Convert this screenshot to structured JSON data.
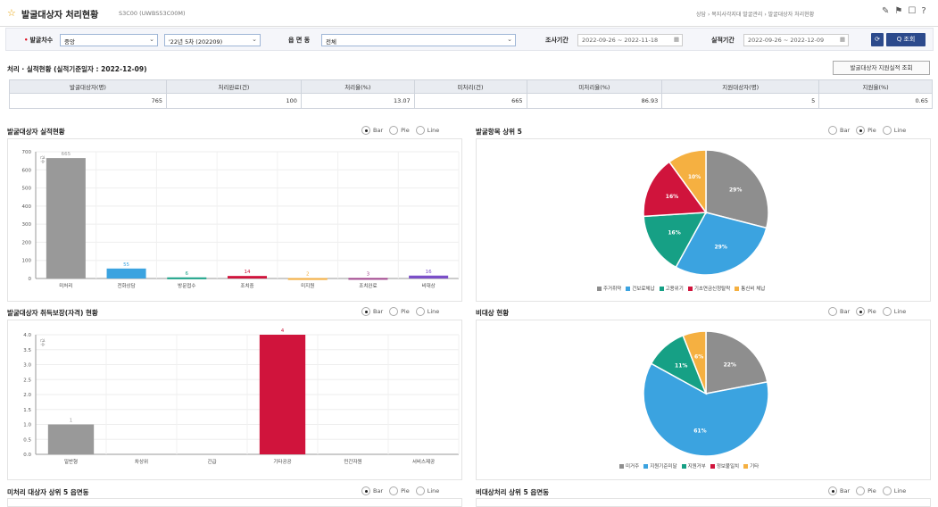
{
  "header": {
    "title": "발굴대상자 처리현황",
    "code": "S3C00 (UWBS53C00M)",
    "breadcrumb": [
      "상담",
      "복지사각지대 발굴관리",
      "발굴대상자 처리현황"
    ]
  },
  "search": {
    "batch_label": "발굴차수",
    "batch_value": "중앙",
    "round_value": "'22년 5차 (202209)",
    "dong_label": "읍 면 동",
    "dong_value": "전체",
    "survey_period_label": "조사기간",
    "survey_period_value": "2022-09-26 ~ 2022-11-18",
    "perf_period_label": "실적기간",
    "perf_period_value": "2022-09-26 ~ 2022-12-09",
    "search_label": "Q 조회"
  },
  "summary": {
    "title": "처리 · 실적현황 (실적기준일자 : 2022-12-09)",
    "support_button": "발굴대상자 지원실적 조회",
    "headers": [
      "발굴대상자(명)",
      "처리완료(건)",
      "처리율(%)",
      "미처리(건)",
      "미처리율(%)",
      "지원대상자(명)",
      "지원율(%)"
    ],
    "values": [
      "765",
      "100",
      "13.07",
      "665",
      "86.93",
      "5",
      "0.65"
    ]
  },
  "radio_labels": [
    "Bar",
    "Pie",
    "Line"
  ],
  "charts": {
    "c1": {
      "title": "발굴대상자 실적현황",
      "selected": "Bar"
    },
    "c2": {
      "title": "발굴항목 상위 5",
      "selected": "Pie"
    },
    "c3": {
      "title": "발굴대상자 취득보장(자격) 현황",
      "selected": "Bar"
    },
    "c4": {
      "title": "비대상 현황",
      "selected": "Pie"
    },
    "c5": {
      "title": "미처리 대상자 상위 5 읍면동",
      "selected": "Bar"
    },
    "c6": {
      "title": "비대상처리 상위 5 읍면동",
      "selected": "Bar"
    }
  },
  "chart_data": [
    {
      "type": "bar",
      "title": "발굴대상자 실적현황",
      "ylabel": "건수",
      "categories": [
        "미처리",
        "전화상담",
        "방문접수",
        "조치중",
        "미지원",
        "조치완료",
        "비대상"
      ],
      "values": [
        665,
        55,
        6,
        14,
        2,
        3,
        16
      ],
      "colors": [
        "#999999",
        "#3ba3e0",
        "#16a085",
        "#d0143c",
        "#f5b041",
        "#a0448c",
        "#7b4fc8"
      ],
      "ylim": [
        0,
        700
      ],
      "yticks": [
        0,
        100,
        200,
        300,
        400,
        500,
        600,
        700
      ]
    },
    {
      "type": "pie",
      "title": "발굴항목 상위 5",
      "labels": [
        "주거취약",
        "건보료체납",
        "고용위기",
        "기초연금신청탈락",
        "통신비 체납"
      ],
      "values": [
        29,
        29,
        16,
        16,
        10
      ],
      "colors": [
        "#8e8e8e",
        "#3ba3e0",
        "#16a085",
        "#d0143c",
        "#f5b041"
      ],
      "slice_labels": [
        "29%",
        "29%",
        "16%",
        "16%",
        "10%"
      ]
    },
    {
      "type": "bar",
      "title": "발굴대상자 취득보장(자격) 현황",
      "ylabel": "건수",
      "categories": [
        "일반형",
        "차상위",
        "긴급",
        "기타공공",
        "민간자원",
        "서비스제공"
      ],
      "values": [
        1,
        0,
        0,
        4,
        0,
        0
      ],
      "colors": [
        "#999999",
        "#3ba3e0",
        "#16a085",
        "#d0143c",
        "#f5b041",
        "#a0448c"
      ],
      "ylim": [
        0,
        4
      ],
      "yticks": [
        "0.0",
        "0.5",
        "1.0",
        "1.5",
        "2.0",
        "2.5",
        "3.0",
        "3.5",
        "4.0"
      ]
    },
    {
      "type": "pie",
      "title": "비대상 현황",
      "labels": [
        "미거주",
        "지원기준미달",
        "지원거부",
        "정보불일치",
        "기타"
      ],
      "values": [
        22,
        61,
        11,
        0,
        6
      ],
      "colors": [
        "#8e8e8e",
        "#3ba3e0",
        "#16a085",
        "#d0143c",
        "#f5b041"
      ],
      "slice_labels": [
        "22%",
        "61%",
        "11%",
        "",
        "6%"
      ]
    }
  ]
}
